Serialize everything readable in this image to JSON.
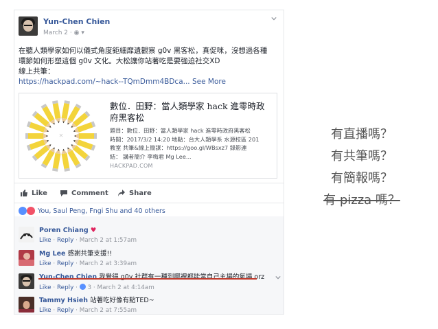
{
  "post": {
    "author": "Yun-Chen Chien",
    "date": "March 2",
    "text_lines": [
      "在聽人類學家如何以儀式角度鉅細靡遺觀察 g0v 黑客松，真促咪，沒想過各種",
      "環節如何形塑這個 g0v 文化。大松讓你站著吃是要強迫社交XD",
      "線上共筆："
    ],
    "link": "https://hackpad.com/~hack--TQmDmm4BDca...",
    "see_more": "See More"
  },
  "preview": {
    "title": "數位．田野：當人類學家 hack 進零時政府黑客松",
    "desc_lines": [
      "題目：數位．田野：當人類學家 hack 進零時政府黑客松",
      "時間：2017/3/2 14:20 地點：台大人類學系 水源校區 201",
      "教室 共筆&線上簡謀：https://goo.gl/WBsxz7 錄影連",
      "結： 講者簡介 李梅君 Mg Lee..."
    ],
    "domain": "HACKPAD.COM"
  },
  "actions": {
    "like": "Like",
    "comment": "Comment",
    "share": "Share"
  },
  "reactions_text": "You, Saul Peng, Fngi Shu and 40 others",
  "comments": [
    {
      "name": "Poren Chiang",
      "text": "",
      "like": "Like",
      "reply": "Reply",
      "time": "March 2 at 1:57am",
      "count": ""
    },
    {
      "name": "Mg Lee",
      "text": "感謝共筆支援!!",
      "like": "Like",
      "reply": "Reply",
      "time": "March 2 at 3:39am",
      "count": ""
    },
    {
      "name": "Yun-Chen Chien",
      "text": "我覺得 g0v 社群有一種到哪裡都能當自己主場的氣場 orz",
      "like": "Like",
      "reply": "Reply",
      "time": "March 2 at 4:14am",
      "count": "3"
    },
    {
      "name": "Tammy Hsieh",
      "text": "站著吃好像有點TED~",
      "like": "Like",
      "reply": "Reply",
      "time": "March 2 at 7:55am",
      "count": ""
    }
  ],
  "side_list": [
    "有直播嗎？",
    "有共筆嗎？",
    "有簡報嗎？",
    "有 pizza 嗎？"
  ],
  "colors": {
    "link": "#365899",
    "underline": "#c0392b"
  }
}
